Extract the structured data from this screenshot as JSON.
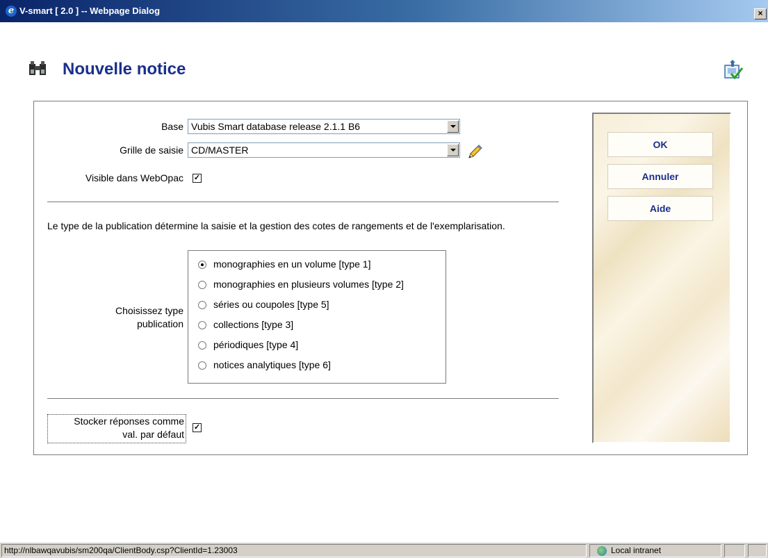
{
  "window": {
    "title": "V-smart [ 2.0 ] -- Webpage Dialog",
    "close_glyph": "×"
  },
  "header": {
    "title": "Nouvelle notice",
    "icon": "binoculars-icon",
    "save_icon": "save-check-icon"
  },
  "form": {
    "base_label": "Base",
    "base_value": "Vubis Smart database release 2.1.1 B6",
    "grille_label": "Grille de saisie",
    "grille_value": "CD/MASTER",
    "visible_label": "Visible dans WebOpac",
    "visible_checked": true,
    "description": "Le type de la publication détermine la saisie et la gestion des cotes de rangements et de l'exemplarisation.",
    "type_label_line1": "Choisissez type",
    "type_label_line2": "publication",
    "types": [
      {
        "label": "monographies en un volume [type 1]",
        "checked": true
      },
      {
        "label": "monographies en plusieurs volumes [type 2]",
        "checked": false
      },
      {
        "label": "séries ou coupoles [type 5]",
        "checked": false
      },
      {
        "label": "collections [type 3]",
        "checked": false
      },
      {
        "label": "périodiques [type 4]",
        "checked": false
      },
      {
        "label": "notices analytiques [type 6]",
        "checked": false
      }
    ],
    "stocker_line1": "Stocker réponses comme",
    "stocker_line2": "val. par défaut",
    "stocker_checked": true,
    "check_glyph": "✓"
  },
  "buttons": {
    "ok": "OK",
    "annuler": "Annuler",
    "aide": "Aide"
  },
  "status": {
    "url": "http://nlbawqavubis/sm200qa/ClientBody.csp?ClientId=1.23003",
    "zone": "Local intranet"
  }
}
